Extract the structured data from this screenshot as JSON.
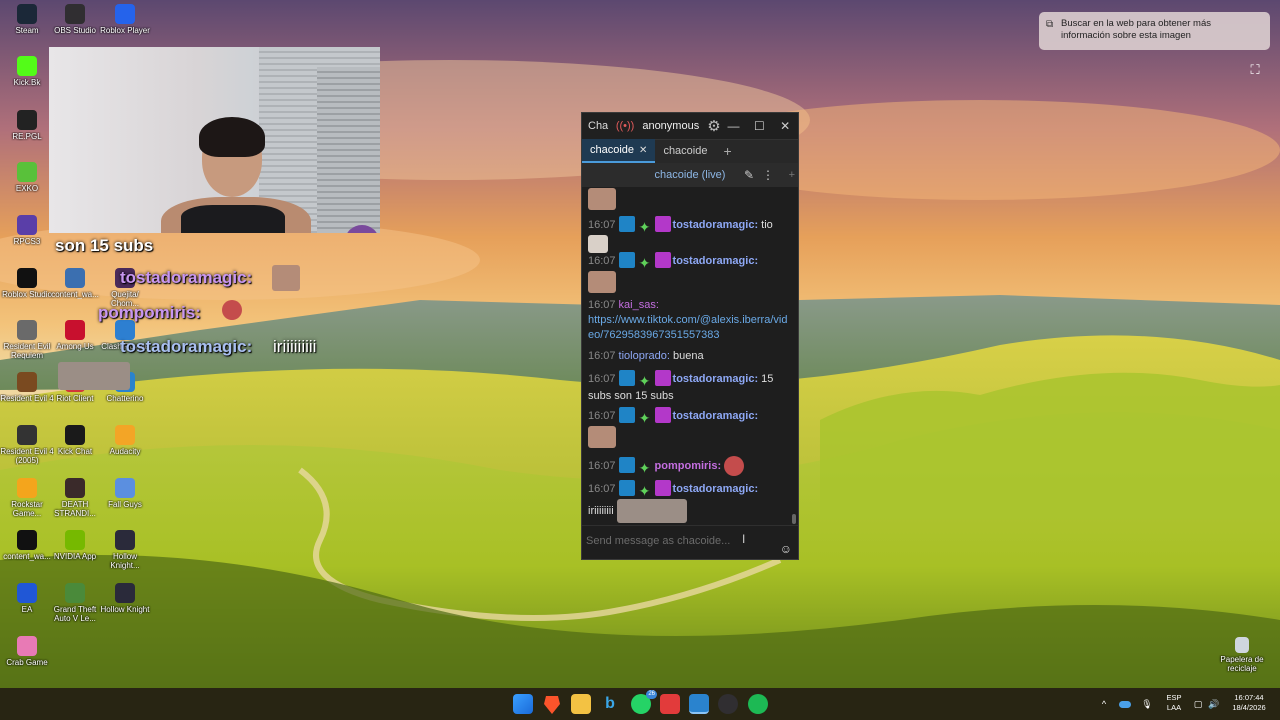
{
  "desktop": {
    "icons": [
      {
        "name": "Steam",
        "color": "#1b2838"
      },
      {
        "name": "OBS Studio",
        "color": "#302e31"
      },
      {
        "name": "Roblox Player",
        "color": "#2563eb"
      },
      {
        "name": "Kick.Bk",
        "color": "#53fc18"
      },
      {
        "name": "RE.PGL",
        "color": "#222222"
      },
      {
        "name": "EXKO",
        "color": "#59c13a"
      },
      {
        "name": "RPCS3",
        "color": "#5a3ea8"
      },
      {
        "name": "Roblox Studio",
        "color": "#111111"
      },
      {
        "name": "content_wa...",
        "color": "#3b6fb0"
      },
      {
        "name": "Quejita/ Chom...",
        "color": "#4a2a5a"
      },
      {
        "name": "Resident Evil Requiem",
        "color": "#6a6a6a"
      },
      {
        "name": "Among Us",
        "color": "#c8102e"
      },
      {
        "name": "Clash Royale",
        "color": "#2d7fd1"
      },
      {
        "name": "Resident Evil 4",
        "color": "#7a4a20"
      },
      {
        "name": "Riot Client",
        "color": "#d13639"
      },
      {
        "name": "Chatterino",
        "color": "#2a83ce"
      },
      {
        "name": "Resident Evil 4 (2005)",
        "color": "#333333"
      },
      {
        "name": "Kick Chat",
        "color": "#1a1a1a"
      },
      {
        "name": "Audacity",
        "color": "#f3a526"
      },
      {
        "name": "Rockstar Game...",
        "color": "#f4a51c"
      },
      {
        "name": "DEATH STRANDI...",
        "color": "#3a2a2a"
      },
      {
        "name": "Fall Guys",
        "color": "#5b8fe0"
      },
      {
        "name": "content_wa...",
        "color": "#111111"
      },
      {
        "name": "NVIDIA App",
        "color": "#76b900"
      },
      {
        "name": "Hollow Knight...",
        "color": "#2a2a3a"
      },
      {
        "name": "EA",
        "color": "#2057d6"
      },
      {
        "name": "Grand Theft Auto V Le...",
        "color": "#4a8a3a"
      },
      {
        "name": "Hollow Knight",
        "color": "#2a2a3a"
      },
      {
        "name": "Crab Game",
        "color": "#e87ab5"
      }
    ],
    "recycle_bin": "Papelera de reciclaje"
  },
  "stream_overlay": {
    "line1": "son 15 subs",
    "line2_user": "tostadoramagic:",
    "line3_user": "pompomiris:",
    "line4_user": "tostadoramagic:",
    "line4_text": "iriiiiiiiii"
  },
  "chat_window": {
    "title": "Cha",
    "live_icon": "live-broadcast-icon",
    "account": "anonymous",
    "tabs": [
      {
        "label": "chacoide",
        "active": true
      },
      {
        "label": "chacoide",
        "active": false
      }
    ],
    "split_header": "chacoide (live)",
    "input_placeholder": "Send message as chacoide...",
    "messages": [
      {
        "time": "16:07",
        "user": "tostadoramagic:",
        "text": "tio"
      },
      {
        "time": "16:07",
        "user": "tostadoramagic:",
        "text": ""
      },
      {
        "time": "16:07",
        "user": "kai_sas:",
        "text": "https://www.tiktok.com/@alexis.iberra/video/7629583967351557383"
      },
      {
        "time": "16:07",
        "user": "tioloprado:",
        "text": "buena"
      },
      {
        "time": "16:07",
        "user": "tostadoramagic:",
        "text": "15 subs son 15 subs"
      },
      {
        "time": "16:07",
        "user": "tostadoramagic:",
        "text": ""
      },
      {
        "time": "16:07",
        "user": "pompomiris:",
        "text": ""
      },
      {
        "time": "16:07",
        "user": "tostadoramagic:",
        "text": "iriiiiiiii"
      }
    ]
  },
  "lens_popup": {
    "text": "Buscar en la web para obtener más información sobre esta imagen"
  },
  "taskbar": {
    "apps": [
      "windows-start",
      "brave",
      "file-explorer",
      "bing",
      "whatsapp",
      "news",
      "chatterino",
      "obs",
      "spotify"
    ],
    "whatsapp_badge": "26",
    "language_line1": "ESP",
    "language_line2": "LAA",
    "time": "16:07:44",
    "date": "18/4/2026"
  }
}
